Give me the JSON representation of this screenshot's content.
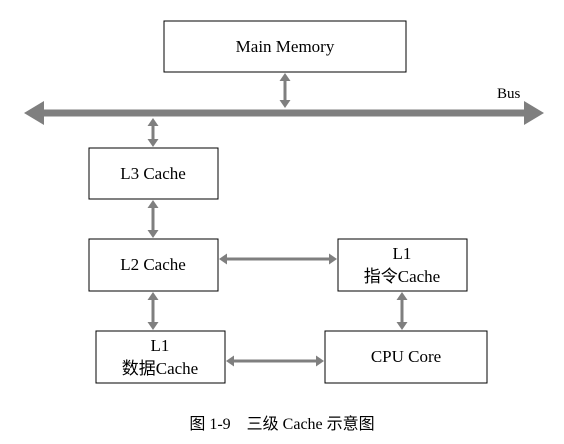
{
  "diagram": {
    "boxes": {
      "main_memory": "Main Memory",
      "l3_cache": "L3 Cache",
      "l2_cache": "L2 Cache",
      "l1_instruction": {
        "line1": "L1",
        "line2": "指令Cache"
      },
      "l1_data": {
        "line1": "L1",
        "line2": "数据Cache"
      },
      "cpu_core": "CPU Core"
    },
    "bus_label": "Bus",
    "caption": "图 1-9　三级 Cache 示意图",
    "colors": {
      "arrow": "#7f7f7f",
      "box_border": "#000000",
      "text": "#000000",
      "background": "#ffffff"
    }
  }
}
